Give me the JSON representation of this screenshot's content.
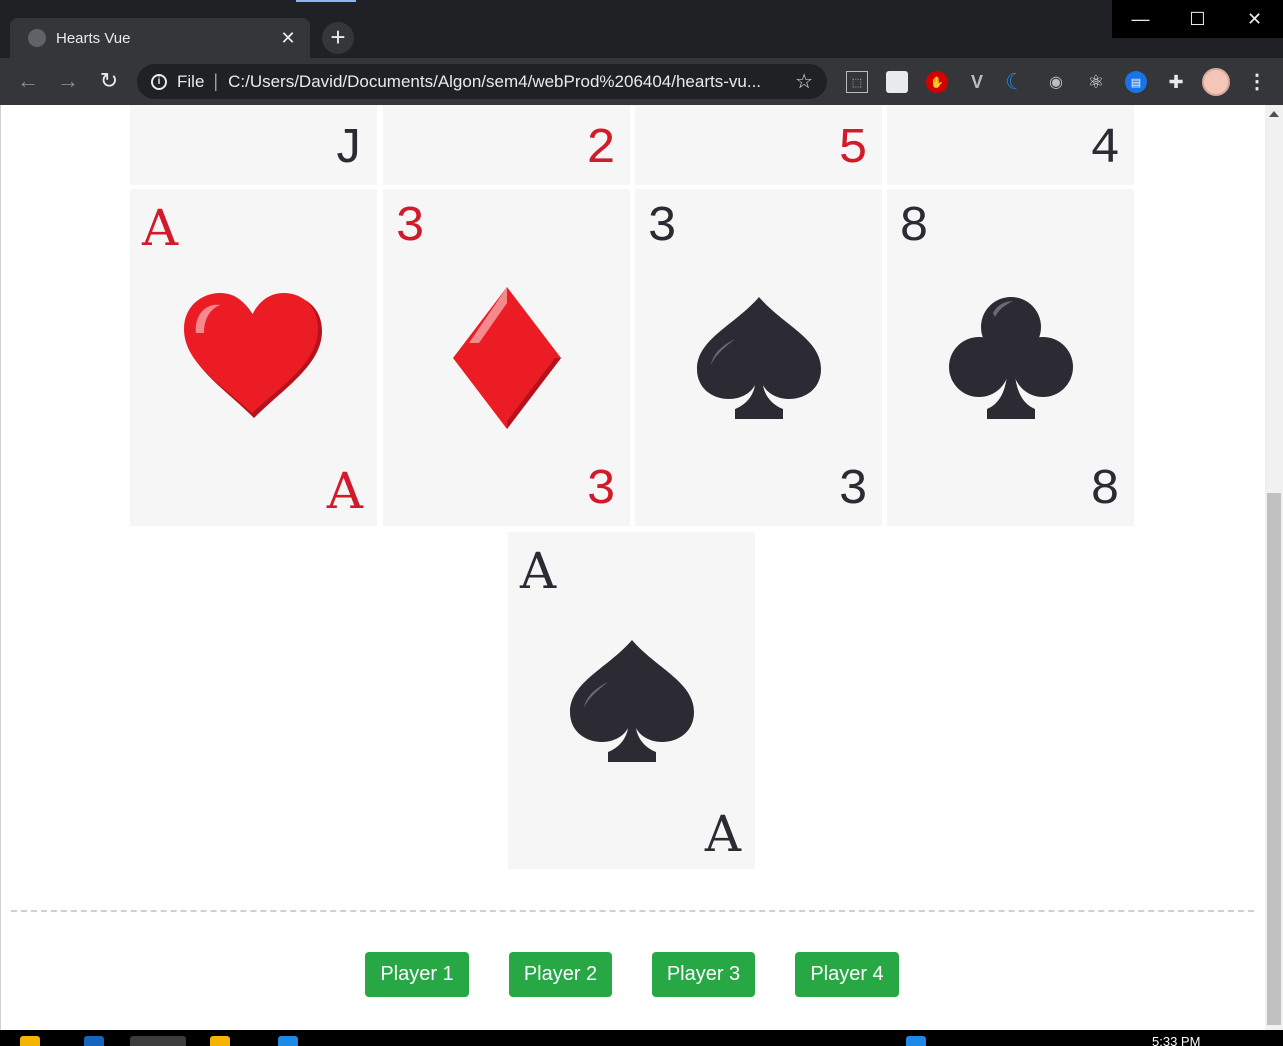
{
  "browser": {
    "tab_title": "Hearts Vue",
    "tab_close": "✕",
    "new_tab": "+",
    "window_minimize": "—",
    "window_maximize": "☐",
    "window_close": "✕",
    "nav_back": "←",
    "nav_forward": "→",
    "reload": "↻",
    "scheme_label": "File",
    "address": "C:/Users/David/Documents/Algon/sem4/webProd%206404/hearts-vu...",
    "bookmark_star": "☆",
    "menu_dots": "⋮",
    "extensions": [
      "pdf-icon",
      "image-icon",
      "stop-icon",
      "vue-icon",
      "moon-icon",
      "camera-icon",
      "react-icon",
      "doc-icon",
      "puzzle-icon"
    ]
  },
  "table": {
    "top_row_partial": [
      {
        "rank": "J",
        "color": "dark"
      },
      {
        "rank": "2",
        "color": "red"
      },
      {
        "rank": "5",
        "color": "red"
      },
      {
        "rank": "4",
        "color": "dark"
      }
    ],
    "played_cards": [
      {
        "rank": "A",
        "suit": "hearts",
        "color": "red"
      },
      {
        "rank": "3",
        "suit": "diamonds",
        "color": "red"
      },
      {
        "rank": "3",
        "suit": "spades",
        "color": "dark"
      },
      {
        "rank": "8",
        "suit": "clubs",
        "color": "dark"
      }
    ],
    "bottom_card": {
      "rank": "A",
      "suit": "spades",
      "color": "dark"
    }
  },
  "players": {
    "buttons": [
      "Player 1",
      "Player 2",
      "Player 3",
      "Player 4"
    ],
    "button_color": "#28a745"
  },
  "colors": {
    "red_suit": "#d11a2a",
    "dark_suit": "#2c2b33",
    "card_bg": "#f6f6f6"
  },
  "taskbar": {
    "clock": "5:33 PM"
  }
}
